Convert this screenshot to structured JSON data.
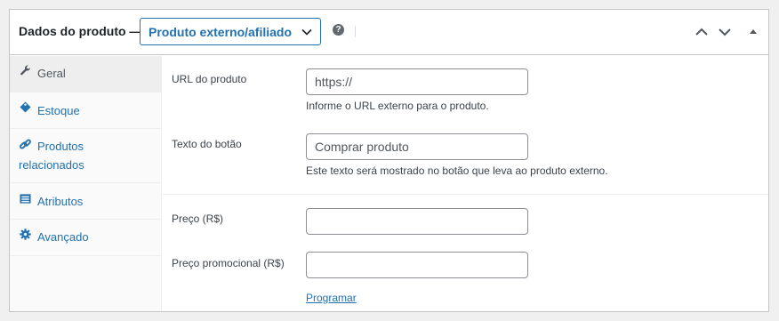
{
  "header": {
    "title": "Dados do produto —",
    "product_type": "Produto externo/afiliado",
    "help_icon": "?"
  },
  "sidebar": {
    "items": [
      {
        "label": "Geral",
        "icon": "wrench-icon",
        "active": true
      },
      {
        "label": "Estoque",
        "icon": "tag-icon"
      },
      {
        "label": "Produtos relacionados",
        "icon": "link-icon"
      },
      {
        "label": "Atributos",
        "icon": "list-table-icon"
      },
      {
        "label": "Avançado",
        "icon": "gear-icon"
      }
    ]
  },
  "fields": {
    "url": {
      "label": "URL do produto",
      "placeholder": "https://",
      "description": "Informe o URL externo para o produto."
    },
    "button_text": {
      "label": "Texto do botão",
      "placeholder": "Comprar produto",
      "description": "Este texto será mostrado no botão que leva ao produto externo."
    },
    "price": {
      "label": "Preço (R$)",
      "value": ""
    },
    "sale_price": {
      "label": "Preço promocional (R$)",
      "value": "",
      "link": "Programar"
    }
  },
  "colors": {
    "accent": "#2271b1",
    "border": "#c3c4c7",
    "text": "#3c434a"
  }
}
